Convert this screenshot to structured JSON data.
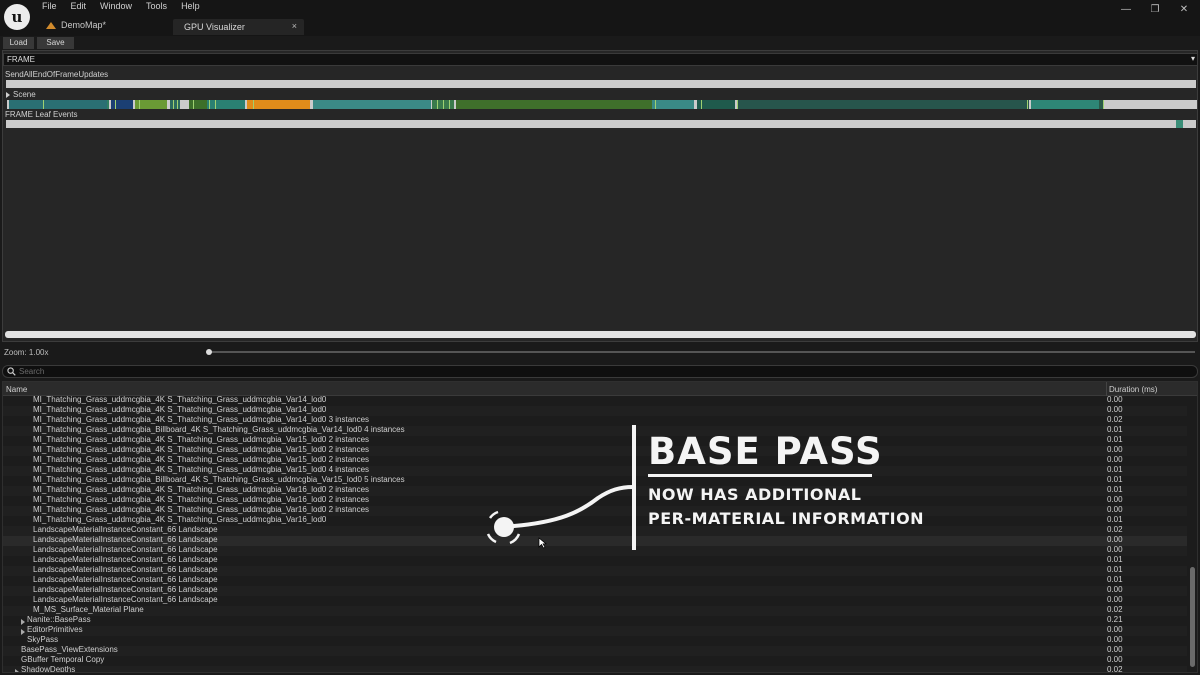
{
  "menu": [
    "File",
    "Edit",
    "Window",
    "Tools",
    "Help"
  ],
  "map_tab": "DemoMap*",
  "doc_tab": {
    "label": "GPU Visualizer",
    "close": "×"
  },
  "window_controls": {
    "minimize": "—",
    "restore": "❐",
    "close": "✕"
  },
  "toolbar": {
    "load": "Load",
    "save": "Save"
  },
  "frame_select": {
    "value": "FRAME",
    "arrow": "▾"
  },
  "events": {
    "end_of_frame": "SendAllEndOfFrameUpdates",
    "scene": "Scene",
    "leaf": "FRAME Leaf Events"
  },
  "zoom": {
    "label": "Zoom: 1.00x"
  },
  "search": {
    "placeholder": "Search"
  },
  "table": {
    "headers": {
      "name": "Name",
      "duration": "Duration (ms)"
    },
    "rows": [
      {
        "name": "MI_Thatching_Grass_uddmcgbia_4K S_Thatching_Grass_uddmcgbia_Var14_lod0",
        "duration": "0.00",
        "indent": 3
      },
      {
        "name": "MI_Thatching_Grass_uddmcgbia_4K S_Thatching_Grass_uddmcgbia_Var14_lod0",
        "duration": "0.00",
        "indent": 3
      },
      {
        "name": "MI_Thatching_Grass_uddmcgbia_4K S_Thatching_Grass_uddmcgbia_Var14_lod0 3 instances",
        "duration": "0.02",
        "indent": 3
      },
      {
        "name": "MI_Thatching_Grass_uddmcgbia_Billboard_4K S_Thatching_Grass_uddmcgbia_Var14_lod0 4 instances",
        "duration": "0.01",
        "indent": 3
      },
      {
        "name": "MI_Thatching_Grass_uddmcgbia_4K S_Thatching_Grass_uddmcgbia_Var15_lod0 2 instances",
        "duration": "0.01",
        "indent": 3
      },
      {
        "name": "MI_Thatching_Grass_uddmcgbia_4K S_Thatching_Grass_uddmcgbia_Var15_lod0 2 instances",
        "duration": "0.00",
        "indent": 3
      },
      {
        "name": "MI_Thatching_Grass_uddmcgbia_4K S_Thatching_Grass_uddmcgbia_Var15_lod0 2 instances",
        "duration": "0.00",
        "indent": 3
      },
      {
        "name": "MI_Thatching_Grass_uddmcgbia_4K S_Thatching_Grass_uddmcgbia_Var15_lod0 4 instances",
        "duration": "0.01",
        "indent": 3
      },
      {
        "name": "MI_Thatching_Grass_uddmcgbia_Billboard_4K S_Thatching_Grass_uddmcgbia_Var15_lod0 5 instances",
        "duration": "0.01",
        "indent": 3
      },
      {
        "name": "MI_Thatching_Grass_uddmcgbia_4K S_Thatching_Grass_uddmcgbia_Var16_lod0 2 instances",
        "duration": "0.01",
        "indent": 3
      },
      {
        "name": "MI_Thatching_Grass_uddmcgbia_4K S_Thatching_Grass_uddmcgbia_Var16_lod0 2 instances",
        "duration": "0.00",
        "indent": 3
      },
      {
        "name": "MI_Thatching_Grass_uddmcgbia_4K S_Thatching_Grass_uddmcgbia_Var16_lod0 2 instances",
        "duration": "0.00",
        "indent": 3
      },
      {
        "name": "MI_Thatching_Grass_uddmcgbia_4K S_Thatching_Grass_uddmcgbia_Var16_lod0",
        "duration": "0.01",
        "indent": 3
      },
      {
        "name": "LandscapeMaterialInstanceConstant_66 Landscape",
        "duration": "0.02",
        "indent": 3
      },
      {
        "name": "LandscapeMaterialInstanceConstant_66 Landscape",
        "duration": "0.00",
        "indent": 3,
        "highlight": true
      },
      {
        "name": "LandscapeMaterialInstanceConstant_66 Landscape",
        "duration": "0.00",
        "indent": 3
      },
      {
        "name": "LandscapeMaterialInstanceConstant_66 Landscape",
        "duration": "0.01",
        "indent": 3
      },
      {
        "name": "LandscapeMaterialInstanceConstant_66 Landscape",
        "duration": "0.01",
        "indent": 3
      },
      {
        "name": "LandscapeMaterialInstanceConstant_66 Landscape",
        "duration": "0.01",
        "indent": 3
      },
      {
        "name": "LandscapeMaterialInstanceConstant_66 Landscape",
        "duration": "0.00",
        "indent": 3
      },
      {
        "name": "LandscapeMaterialInstanceConstant_66 Landscape",
        "duration": "0.00",
        "indent": 3
      },
      {
        "name": "M_MS_Surface_Material Plane",
        "duration": "0.02",
        "indent": 3
      },
      {
        "name": "Nanite::BasePass",
        "duration": "0.21",
        "indent": 2,
        "expandable": true
      },
      {
        "name": "EditorPrimitives",
        "duration": "0.00",
        "indent": 2,
        "expandable": true
      },
      {
        "name": "SkyPass",
        "duration": "0.00",
        "indent": 2
      },
      {
        "name": "BasePass_ViewExtensions",
        "duration": "0.00",
        "indent": 1
      },
      {
        "name": "GBuffer Temporal Copy",
        "duration": "0.00",
        "indent": 1
      },
      {
        "name": "ShadowDepths",
        "duration": "0.02",
        "indent": 1,
        "expandable": true
      }
    ]
  },
  "overlay": {
    "title": "BASE PASS",
    "line1": "NOW HAS ADDITIONAL",
    "line2": "PER-MATERIAL INFORMATION"
  },
  "scene_segments": [
    {
      "color": "#2a6f73"
    },
    {
      "color": "#2e7f62"
    },
    {
      "color": "#1b3f73"
    },
    {
      "color": "#6a9a35"
    },
    {
      "color": "#2b6a5e"
    },
    {
      "color": "#3d6f2a"
    },
    {
      "color": "#2a8072"
    },
    {
      "color": "#e08c1a"
    },
    {
      "color": "#3b8a86"
    },
    {
      "color": "#3a7a4c"
    },
    {
      "color": "#7aaa3e"
    },
    {
      "color": "#3f6f2b"
    },
    {
      "color": "#2e5f2a"
    },
    {
      "color": "#3a8a86"
    },
    {
      "color": "#1f5a4c"
    },
    {
      "color": "#27554c"
    },
    {
      "color": "#2a5a48"
    },
    {
      "color": "#2e8676"
    }
  ]
}
